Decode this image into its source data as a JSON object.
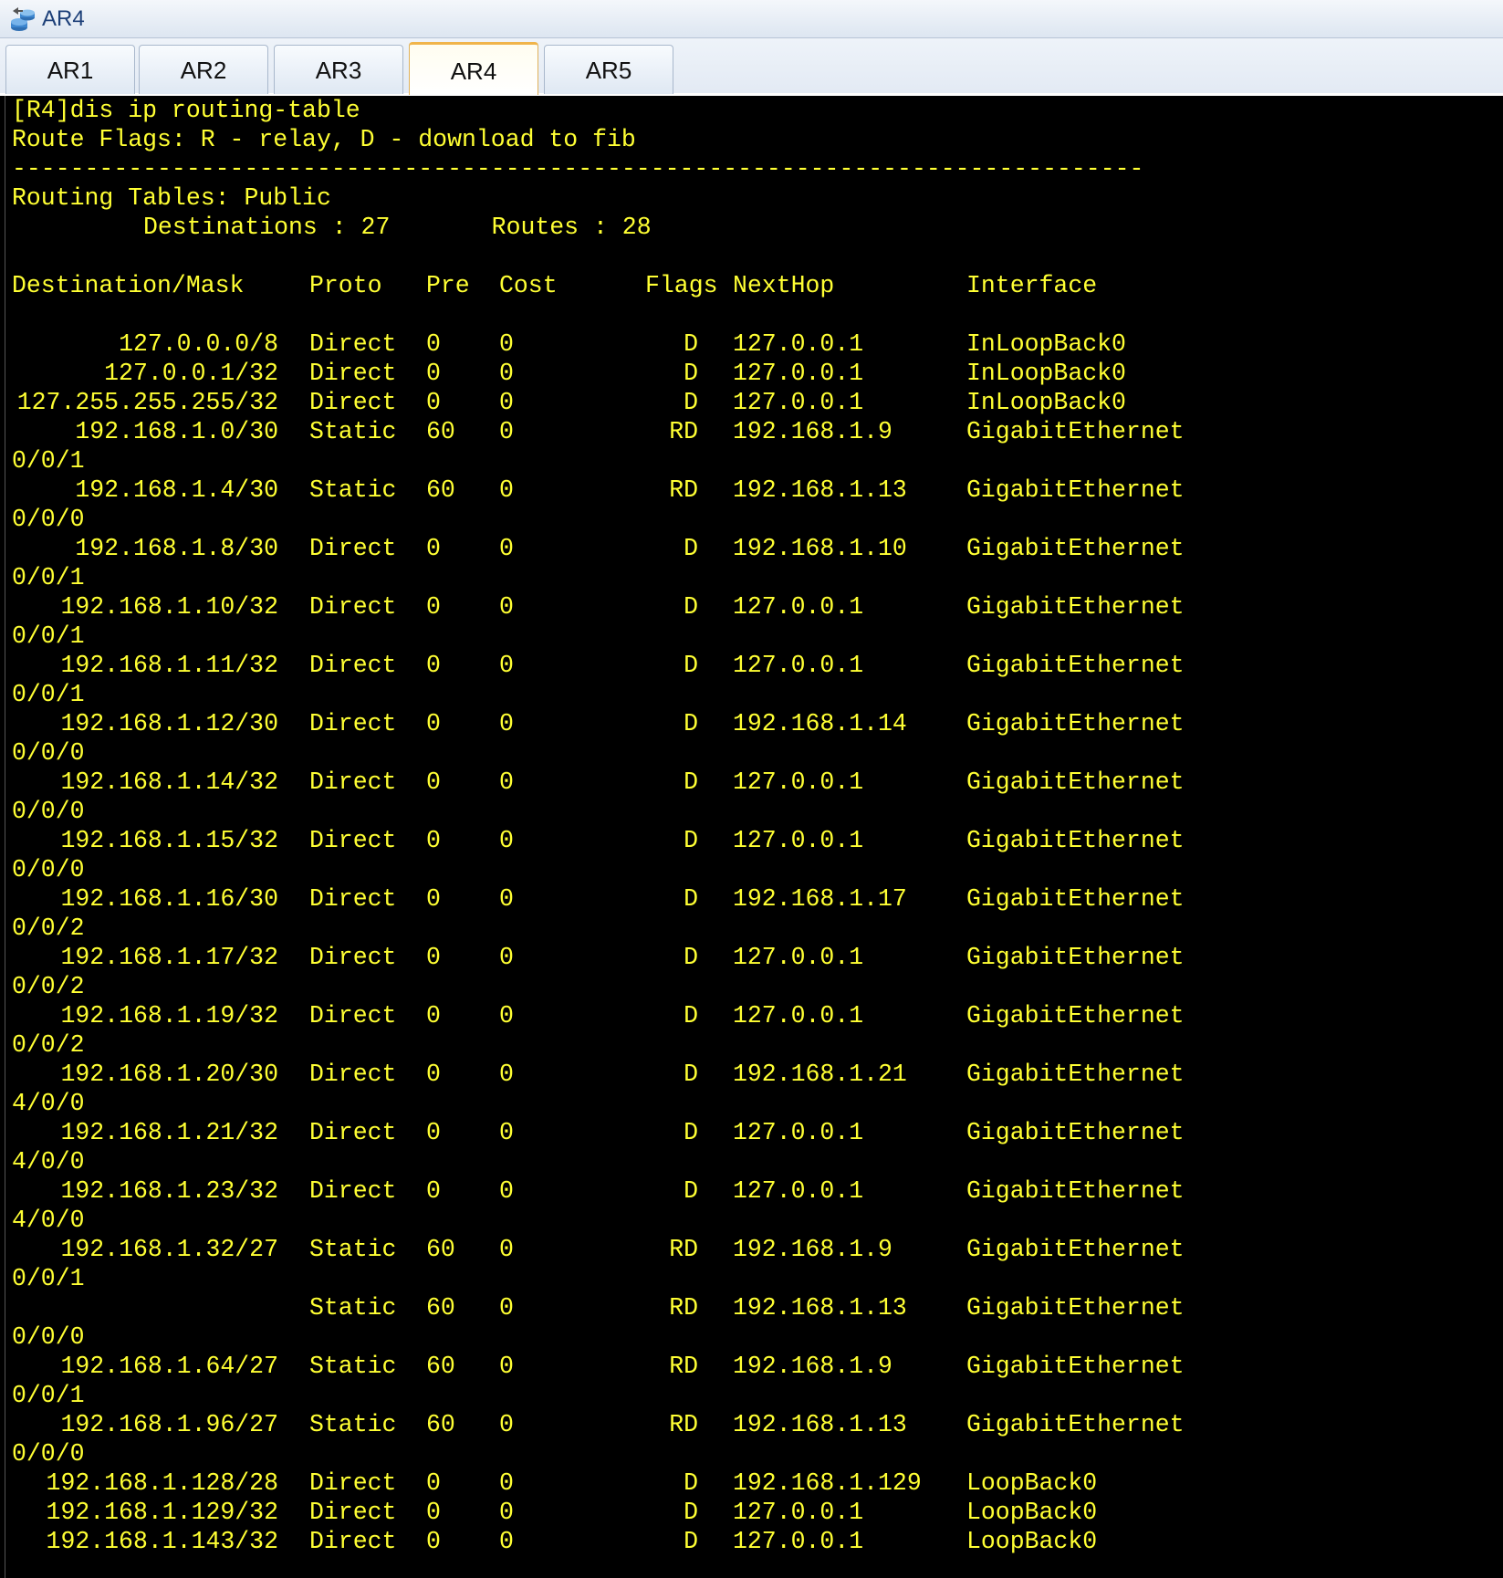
{
  "window": {
    "title": "AR4",
    "icon": "router-cluster-icon"
  },
  "tabs": [
    {
      "label": "AR1",
      "active": false
    },
    {
      "label": "AR2",
      "active": false
    },
    {
      "label": "AR3",
      "active": false
    },
    {
      "label": "AR4",
      "active": true
    },
    {
      "label": "AR5",
      "active": false
    }
  ],
  "console": {
    "colors": {
      "background": "#000000",
      "text": "#ffff33"
    },
    "command": "[R4]dis ip routing-table",
    "flags_legend": "Route Flags: R - relay, D - download to fib",
    "separator": "------------------------------------------------------------------------------",
    "table_name": "Routing Tables: Public",
    "summary": "Destinations : 27       Routes : 28",
    "headers": {
      "destination": "Destination/Mask",
      "proto": "Proto",
      "pre": "Pre",
      "cost": "Cost",
      "flags": "Flags",
      "nexthop": "NextHop",
      "interface": "Interface"
    },
    "routes": [
      {
        "dest": "127.0.0.0/8",
        "proto": "Direct",
        "pre": "0",
        "cost": "0",
        "flags": "D",
        "nexthop": "127.0.0.1",
        "iface": "InLoopBack0",
        "cont": ""
      },
      {
        "dest": "127.0.0.1/32",
        "proto": "Direct",
        "pre": "0",
        "cost": "0",
        "flags": "D",
        "nexthop": "127.0.0.1",
        "iface": "InLoopBack0",
        "cont": ""
      },
      {
        "dest": "127.255.255.255/32",
        "proto": "Direct",
        "pre": "0",
        "cost": "0",
        "flags": "D",
        "nexthop": "127.0.0.1",
        "iface": "InLoopBack0",
        "cont": ""
      },
      {
        "dest": "192.168.1.0/30",
        "proto": "Static",
        "pre": "60",
        "cost": "0",
        "flags": "RD",
        "nexthop": "192.168.1.9",
        "iface": "GigabitEthernet",
        "cont": "0/0/1"
      },
      {
        "dest": "192.168.1.4/30",
        "proto": "Static",
        "pre": "60",
        "cost": "0",
        "flags": "RD",
        "nexthop": "192.168.1.13",
        "iface": "GigabitEthernet",
        "cont": "0/0/0"
      },
      {
        "dest": "192.168.1.8/30",
        "proto": "Direct",
        "pre": "0",
        "cost": "0",
        "flags": "D",
        "nexthop": "192.168.1.10",
        "iface": "GigabitEthernet",
        "cont": "0/0/1"
      },
      {
        "dest": "192.168.1.10/32",
        "proto": "Direct",
        "pre": "0",
        "cost": "0",
        "flags": "D",
        "nexthop": "127.0.0.1",
        "iface": "GigabitEthernet",
        "cont": "0/0/1"
      },
      {
        "dest": "192.168.1.11/32",
        "proto": "Direct",
        "pre": "0",
        "cost": "0",
        "flags": "D",
        "nexthop": "127.0.0.1",
        "iface": "GigabitEthernet",
        "cont": "0/0/1"
      },
      {
        "dest": "192.168.1.12/30",
        "proto": "Direct",
        "pre": "0",
        "cost": "0",
        "flags": "D",
        "nexthop": "192.168.1.14",
        "iface": "GigabitEthernet",
        "cont": "0/0/0"
      },
      {
        "dest": "192.168.1.14/32",
        "proto": "Direct",
        "pre": "0",
        "cost": "0",
        "flags": "D",
        "nexthop": "127.0.0.1",
        "iface": "GigabitEthernet",
        "cont": "0/0/0"
      },
      {
        "dest": "192.168.1.15/32",
        "proto": "Direct",
        "pre": "0",
        "cost": "0",
        "flags": "D",
        "nexthop": "127.0.0.1",
        "iface": "GigabitEthernet",
        "cont": "0/0/0"
      },
      {
        "dest": "192.168.1.16/30",
        "proto": "Direct",
        "pre": "0",
        "cost": "0",
        "flags": "D",
        "nexthop": "192.168.1.17",
        "iface": "GigabitEthernet",
        "cont": "0/0/2"
      },
      {
        "dest": "192.168.1.17/32",
        "proto": "Direct",
        "pre": "0",
        "cost": "0",
        "flags": "D",
        "nexthop": "127.0.0.1",
        "iface": "GigabitEthernet",
        "cont": "0/0/2"
      },
      {
        "dest": "192.168.1.19/32",
        "proto": "Direct",
        "pre": "0",
        "cost": "0",
        "flags": "D",
        "nexthop": "127.0.0.1",
        "iface": "GigabitEthernet",
        "cont": "0/0/2"
      },
      {
        "dest": "192.168.1.20/30",
        "proto": "Direct",
        "pre": "0",
        "cost": "0",
        "flags": "D",
        "nexthop": "192.168.1.21",
        "iface": "GigabitEthernet",
        "cont": "4/0/0"
      },
      {
        "dest": "192.168.1.21/32",
        "proto": "Direct",
        "pre": "0",
        "cost": "0",
        "flags": "D",
        "nexthop": "127.0.0.1",
        "iface": "GigabitEthernet",
        "cont": "4/0/0"
      },
      {
        "dest": "192.168.1.23/32",
        "proto": "Direct",
        "pre": "0",
        "cost": "0",
        "flags": "D",
        "nexthop": "127.0.0.1",
        "iface": "GigabitEthernet",
        "cont": "4/0/0"
      },
      {
        "dest": "192.168.1.32/27",
        "proto": "Static",
        "pre": "60",
        "cost": "0",
        "flags": "RD",
        "nexthop": "192.168.1.9",
        "iface": "GigabitEthernet",
        "cont": "0/0/1"
      },
      {
        "dest": "",
        "proto": "Static",
        "pre": "60",
        "cost": "0",
        "flags": "RD",
        "nexthop": "192.168.1.13",
        "iface": "GigabitEthernet",
        "cont": "0/0/0"
      },
      {
        "dest": "192.168.1.64/27",
        "proto": "Static",
        "pre": "60",
        "cost": "0",
        "flags": "RD",
        "nexthop": "192.168.1.9",
        "iface": "GigabitEthernet",
        "cont": "0/0/1"
      },
      {
        "dest": "192.168.1.96/27",
        "proto": "Static",
        "pre": "60",
        "cost": "0",
        "flags": "RD",
        "nexthop": "192.168.1.13",
        "iface": "GigabitEthernet",
        "cont": "0/0/0"
      },
      {
        "dest": "192.168.1.128/28",
        "proto": "Direct",
        "pre": "0",
        "cost": "0",
        "flags": "D",
        "nexthop": "192.168.1.129",
        "iface": "LoopBack0",
        "cont": ""
      },
      {
        "dest": "192.168.1.129/32",
        "proto": "Direct",
        "pre": "0",
        "cost": "0",
        "flags": "D",
        "nexthop": "127.0.0.1",
        "iface": "LoopBack0",
        "cont": ""
      },
      {
        "dest": "192.168.1.143/32",
        "proto": "Direct",
        "pre": "0",
        "cost": "0",
        "flags": "D",
        "nexthop": "127.0.0.1",
        "iface": "LoopBack0",
        "cont": ""
      }
    ]
  }
}
